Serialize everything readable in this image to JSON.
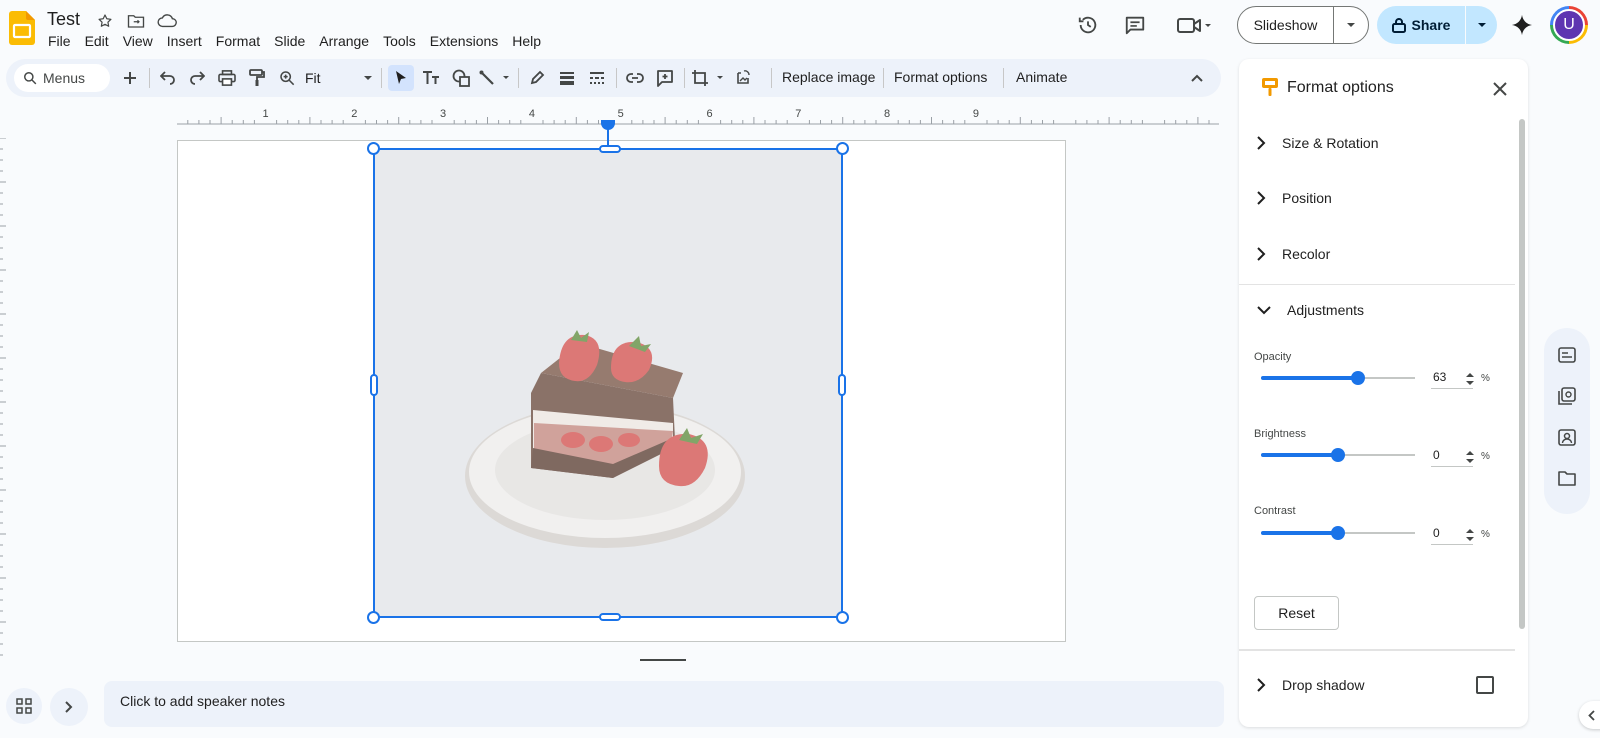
{
  "header": {
    "title": "Test",
    "menu": [
      "File",
      "Edit",
      "View",
      "Insert",
      "Format",
      "Slide",
      "Arrange",
      "Tools",
      "Extensions",
      "Help"
    ],
    "slideshow_label": "Slideshow",
    "share_label": "Share",
    "avatar_initial": "U"
  },
  "toolbar": {
    "search_placeholder": "Menus",
    "zoom_value": "Fit",
    "replace_image": "Replace image",
    "format_options": "Format options",
    "animate": "Animate"
  },
  "ruler": {
    "ticks": [
      "1",
      "2",
      "3",
      "4",
      "5",
      "6",
      "7",
      "8",
      "9"
    ]
  },
  "notes": {
    "placeholder": "Click to add speaker notes"
  },
  "panel": {
    "title": "Format options",
    "sections": {
      "size_rotation": "Size & Rotation",
      "position": "Position",
      "recolor": "Recolor",
      "adjustments": "Adjustments",
      "drop_shadow": "Drop shadow"
    },
    "adjustments": {
      "opacity_label": "Opacity",
      "opacity_value": "63",
      "opacity_fraction": 0.63,
      "brightness_label": "Brightness",
      "brightness_value": "0",
      "brightness_fraction": 0.5,
      "contrast_label": "Contrast",
      "contrast_value": "0",
      "contrast_fraction": 0.5,
      "unit": "%"
    },
    "reset_label": "Reset",
    "drop_shadow_checked": false
  },
  "colors": {
    "accent": "#1a73e8",
    "share_bg": "#c2e7ff",
    "toolbar_bg": "#edf2fa",
    "app_icon": "#fbbc04"
  }
}
